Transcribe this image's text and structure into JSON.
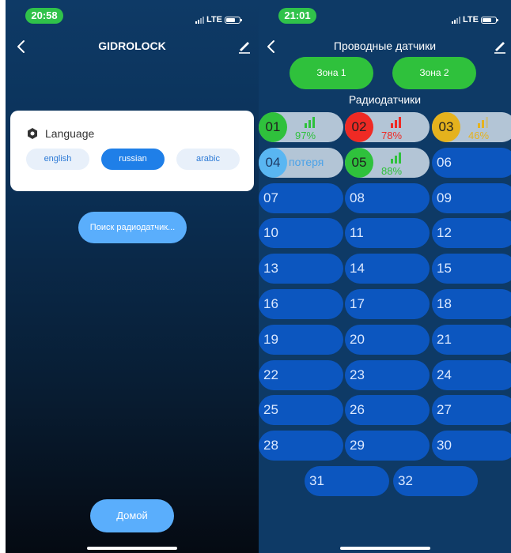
{
  "left": {
    "status": {
      "time": "20:58",
      "network": "LTE"
    },
    "title": "GIDROLOCK",
    "language": {
      "label": "Language",
      "options": [
        {
          "label": "english",
          "active": false
        },
        {
          "label": "russian",
          "active": true
        },
        {
          "label": "arabic",
          "active": false
        }
      ]
    },
    "search_button": "Поиск радиодатчик...",
    "home_button": "Домой"
  },
  "right": {
    "status": {
      "time": "21:01",
      "network": "LTE"
    },
    "title": "Проводные датчики",
    "zones": [
      "Зона 1",
      "Зона 2"
    ],
    "section_title": "Радиодатчики",
    "colors": {
      "green": "#2fc13c",
      "red": "#ef2a24",
      "yellow": "#e5b21d",
      "blue_tile": "#0c56bf",
      "active_tile": "#b3c5d6",
      "lost": "#59b6f2"
    },
    "sensors": [
      {
        "num": "01",
        "state": "signal",
        "color": "#2fc13c",
        "percent": "97%",
        "signal_bars": 3
      },
      {
        "num": "02",
        "state": "signal",
        "color": "#ef2a24",
        "percent": "78%",
        "signal_bars": 3
      },
      {
        "num": "03",
        "state": "signal",
        "color": "#e5b21d",
        "percent": "46%",
        "signal_bars": 2
      },
      {
        "num": "04",
        "state": "lost",
        "lost_text": "потеря"
      },
      {
        "num": "05",
        "state": "signal",
        "color": "#2fc13c",
        "percent": "88%",
        "signal_bars": 3
      },
      {
        "num": "06"
      },
      {
        "num": "07"
      },
      {
        "num": "08"
      },
      {
        "num": "09"
      },
      {
        "num": "10"
      },
      {
        "num": "11"
      },
      {
        "num": "12"
      },
      {
        "num": "13"
      },
      {
        "num": "14"
      },
      {
        "num": "15"
      },
      {
        "num": "16"
      },
      {
        "num": "17"
      },
      {
        "num": "18"
      },
      {
        "num": "19"
      },
      {
        "num": "20"
      },
      {
        "num": "21"
      },
      {
        "num": "22"
      },
      {
        "num": "23"
      },
      {
        "num": "24"
      },
      {
        "num": "25"
      },
      {
        "num": "26"
      },
      {
        "num": "27"
      },
      {
        "num": "28"
      },
      {
        "num": "29"
      },
      {
        "num": "30"
      },
      {
        "num": "31"
      },
      {
        "num": "32"
      }
    ]
  }
}
